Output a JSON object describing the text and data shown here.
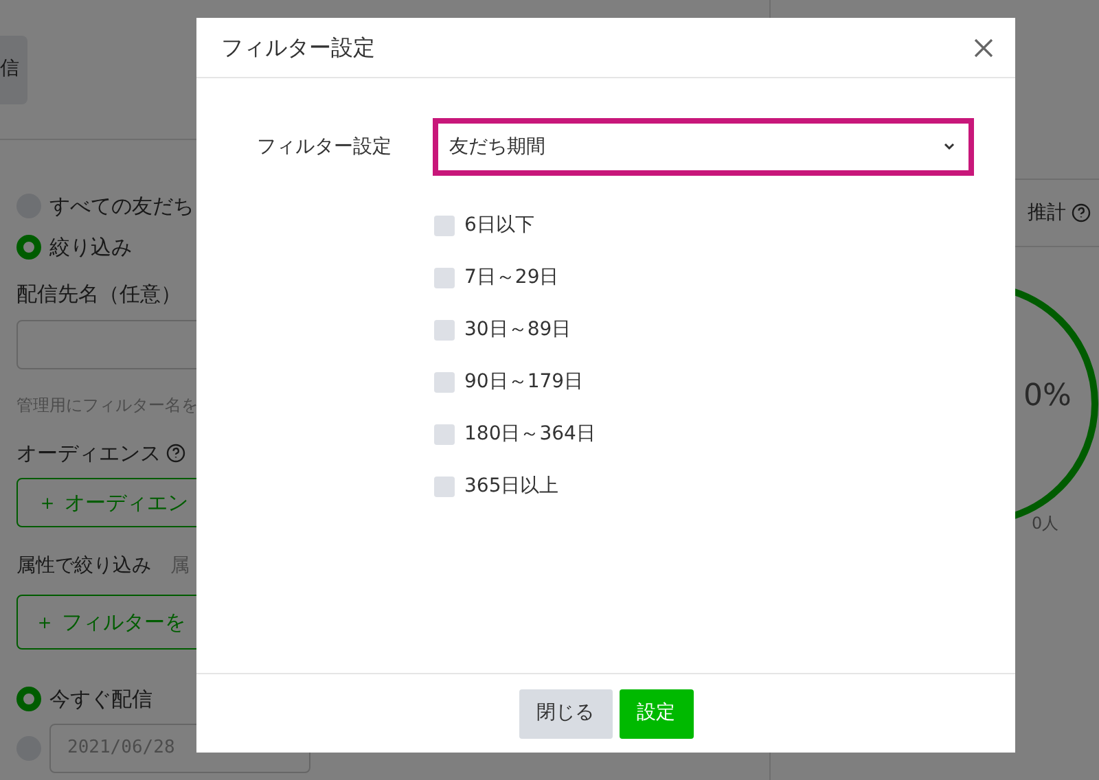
{
  "background": {
    "tab_button": "信",
    "radios": [
      {
        "label": "すべての友だち",
        "selected": false
      },
      {
        "label": "絞り込み",
        "selected": true
      }
    ],
    "name_label": "配信先名（任意）",
    "name_hint": "管理用にフィルター名を",
    "audience_label": "オーディエンス",
    "audience_button": "＋ オーディエン",
    "attribute_label": "属性で絞り込み",
    "attribute_hint": "属",
    "filter_button": "＋ フィルターを",
    "schedule": [
      {
        "label": "今すぐ配信",
        "selected": true
      },
      {
        "date": "2021/06/28",
        "selected": false
      }
    ],
    "estimate_label": "推計",
    "percent": "0%",
    "people": "0人"
  },
  "dialog": {
    "title": "フィルター設定",
    "field_label": "フィルター設定",
    "select_value": "友だち期間",
    "options": [
      {
        "label": "6日以下",
        "checked": false
      },
      {
        "label": "7日～29日",
        "checked": false
      },
      {
        "label": "30日～89日",
        "checked": false
      },
      {
        "label": "90日～179日",
        "checked": false
      },
      {
        "label": "180日～364日",
        "checked": false
      },
      {
        "label": "365日以上",
        "checked": false
      }
    ],
    "buttons": [
      {
        "label": "閉じる",
        "kind": "secondary"
      },
      {
        "label": "設定",
        "kind": "primary"
      }
    ]
  }
}
